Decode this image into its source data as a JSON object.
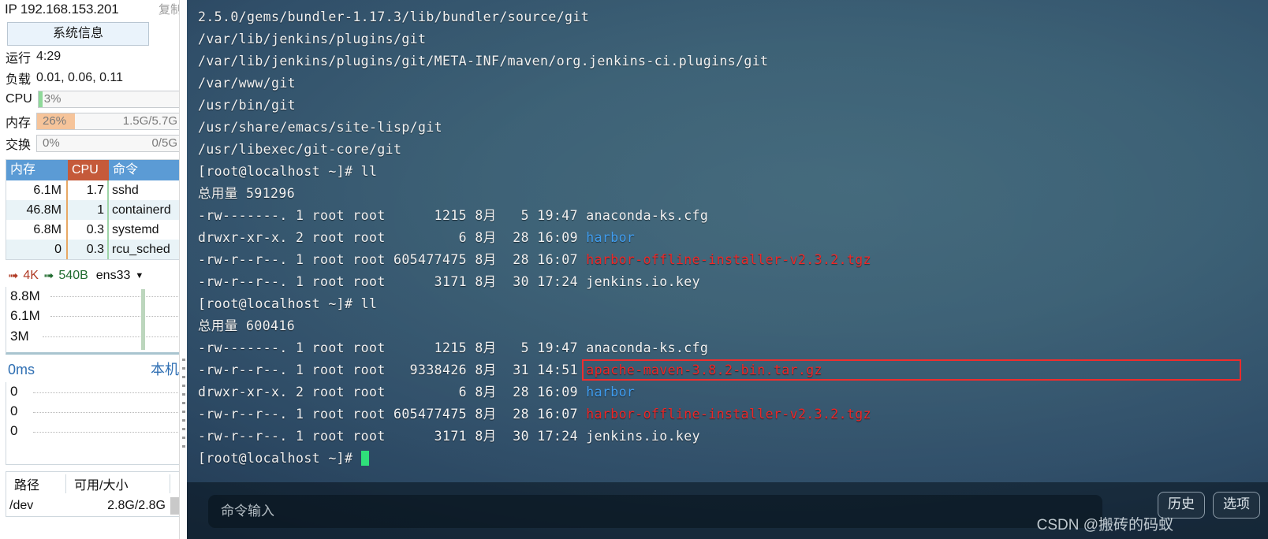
{
  "sidebar": {
    "ip_label": "IP 192.168.153.201",
    "copy_label": "复制",
    "sysinfo_button": "系统信息",
    "uptime_label": "运行",
    "uptime_value": "4:29",
    "load_label": "负载",
    "load_value": "0.01, 0.06, 0.11",
    "cpu": {
      "label": "CPU",
      "percent": "3%",
      "fill_pct": 3,
      "fill_color": "#8fd99a",
      "right": ""
    },
    "mem": {
      "label": "内存",
      "percent": "26%",
      "fill_pct": 26,
      "fill_color": "#f6c49a",
      "right": "1.5G/5.7G"
    },
    "swap": {
      "label": "交换",
      "percent": "0%",
      "fill_pct": 0,
      "fill_color": "#cccccc",
      "right": "0/5G"
    },
    "proc_table": {
      "headers": [
        "内存",
        "CPU",
        "命令"
      ],
      "rows": [
        {
          "mem": "6.1M",
          "cpu": "1.7",
          "cmd": "sshd"
        },
        {
          "mem": "46.8M",
          "cpu": "1",
          "cmd": "containerd"
        },
        {
          "mem": "6.8M",
          "cpu": "0.3",
          "cmd": "systemd"
        },
        {
          "mem": "0",
          "cpu": "0.3",
          "cmd": "rcu_sched"
        }
      ]
    },
    "net": {
      "up_value": "4K",
      "down_value": "540B",
      "interface": "ens33",
      "scale_labels": [
        "8.8M",
        "6.1M",
        "3M"
      ]
    },
    "latency": {
      "value": "0ms",
      "target": "本机",
      "scale_labels": [
        "0",
        "0",
        "0"
      ]
    },
    "disk": {
      "headers": [
        "路径",
        "可用/大小",
        ""
      ],
      "rows": [
        {
          "path": "/dev",
          "size": "2.8G/2.8G"
        }
      ]
    }
  },
  "terminal": {
    "lines": [
      {
        "text": "2.5.0/gems/bundler-1.17.3/lib/bundler/source/git"
      },
      {
        "text": "/var/lib/jenkins/plugins/git"
      },
      {
        "text": "/var/lib/jenkins/plugins/git/META-INF/maven/org.jenkins-ci.plugins/git"
      },
      {
        "text": "/var/www/git"
      },
      {
        "text": "/usr/bin/git"
      },
      {
        "text": "/usr/share/emacs/site-lisp/git"
      },
      {
        "text": "/usr/libexec/git-core/git"
      },
      {
        "text": "[root@localhost ~]# ll"
      },
      {
        "text": "总用量 591296"
      },
      {
        "text": "-rw-------. 1 root root      1215 8月   5 19:47 anaconda-ks.cfg"
      },
      {
        "text": "drwxr-xr-x. 2 root root         6 8月  28 16:09 ",
        "name": "harbor",
        "type": "dir"
      },
      {
        "text": "-rw-r--r--. 1 root root 605477475 8月  28 16:07 ",
        "name": "harbor-offline-installer-v2.3.2.tgz",
        "type": "archive"
      },
      {
        "text": "-rw-r--r--. 1 root root      3171 8月  30 17:24 jenkins.io.key"
      },
      {
        "text": "[root@localhost ~]# ll"
      },
      {
        "text": "总用量 600416"
      },
      {
        "text": "-rw-------. 1 root root      1215 8月   5 19:47 anaconda-ks.cfg"
      },
      {
        "text": "-rw-r--r--. 1 root root   9338426 8月  31 14:51 ",
        "name": "apache-maven-3.8.2-bin.tar.gz",
        "type": "archive"
      },
      {
        "text": "drwxr-xr-x. 2 root root         6 8月  28 16:09 ",
        "name": "harbor",
        "type": "dir"
      },
      {
        "text": "-rw-r--r--. 1 root root 605477475 8月  28 16:07 ",
        "name": "harbor-offline-installer-v2.3.2.tgz",
        "type": "archive"
      },
      {
        "text": "-rw-r--r--. 1 root root      3171 8月  30 17:24 jenkins.io.key"
      },
      {
        "text": "[root@localhost ~]# "
      }
    ],
    "highlight_target": "apache-maven-3.8.2-bin.tar.gz",
    "highlight_color": "#ef2a2a",
    "prompt": "[root@localhost ~]#"
  },
  "command_bar": {
    "input_value": "",
    "input_placeholder": "命令输入",
    "history_button": "历史",
    "options_button": "选项"
  },
  "watermark": "CSDN @搬砖的码蚁",
  "colors": {
    "terminal_bg": "#3a5f74",
    "dir_color": "#3b9bf0",
    "archive_color": "#ee2222",
    "cursor_color": "#2fe07a",
    "header_blue": "#5b9bd5",
    "header_red": "#c55a3a"
  }
}
